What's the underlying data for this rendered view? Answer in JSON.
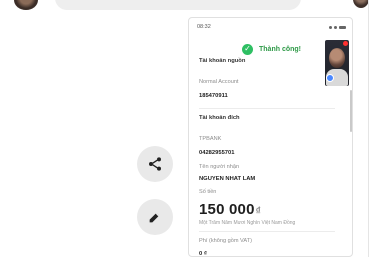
{
  "screenshot": {
    "status_time": "08:32",
    "success_text": "Thành công!",
    "source_account_heading": "Tài khoản nguồn",
    "source_account_label": "Normal Account",
    "source_account_number": "185470911",
    "destination_heading": "Tài khoản đích",
    "bank_name": "TPBANK",
    "destination_account_number": "04282955701",
    "recipient_label": "Tên người nhận",
    "recipient_name": "NGUYEN NHAT LAM",
    "amount_label": "Số tiền",
    "amount_value": "150 000",
    "currency_symbol": "₫",
    "amount_words": "Một Trăm Năm Mươi Nghìn Việt Nam Đồng",
    "fee_label": "Phí (không gồm VAT)",
    "fee_value": "0 ₫"
  },
  "icons": {
    "share": "share-icon",
    "edit": "pencil-icon",
    "success": "check-circle-icon"
  },
  "colors": {
    "success": "#2ebf63",
    "button_bg": "#e9e9e9",
    "text_dark": "#1e1e1e"
  }
}
